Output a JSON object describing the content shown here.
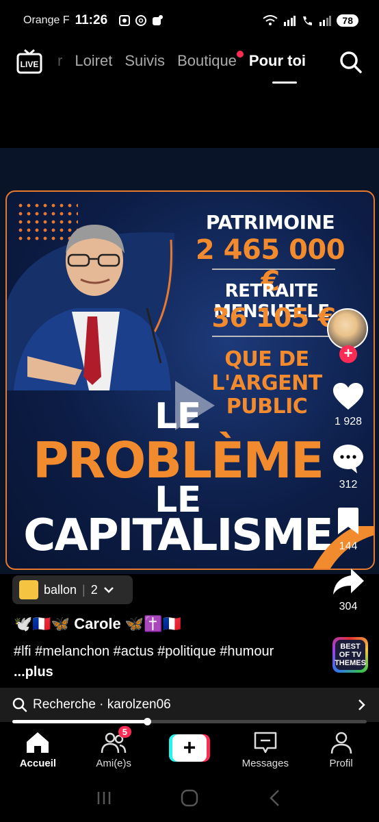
{
  "status": {
    "carrier": "Orange F",
    "time": "11:26",
    "battery": "78"
  },
  "topnav": {
    "live": "LIVE",
    "tabs": [
      {
        "label": "r"
      },
      {
        "label": "Loiret"
      },
      {
        "label": "Suivis"
      },
      {
        "label": "Boutique"
      },
      {
        "label": "Pour toi"
      }
    ]
  },
  "video": {
    "patrimoine_label": "PATRIMOINE",
    "patrimoine_value": "2 465 000 €",
    "retraite_label": "RETRAITE MENSUELLE",
    "retraite_value": "36 105 €",
    "argent": "QUE DE L'ARGENT PUBLIC",
    "le1": "LE",
    "probleme": "PROBLÈME",
    "le2": "LE",
    "capitalisme": "CAPITALISME"
  },
  "rail": {
    "follow": "+",
    "likes": "1 928",
    "comments": "312",
    "saves": "144",
    "shares": "304"
  },
  "chip": {
    "label": "ballon",
    "count": "2"
  },
  "post": {
    "author": "🕊️🇫🇷🦋 Carole 🦋✝️🇫🇷",
    "tags": "#lfi #melanchon #actus #politique #humour",
    "more": "...plus"
  },
  "music": {
    "label": "BEST OF TV THEMES"
  },
  "searchbar": {
    "text": "Recherche · karolzen06"
  },
  "progress": {
    "fraction": 0.38
  },
  "bottomnav": {
    "home": "Accueil",
    "friends": "Ami(e)s",
    "friends_badge": "5",
    "create": "+",
    "messages": "Messages",
    "profile": "Profil"
  }
}
